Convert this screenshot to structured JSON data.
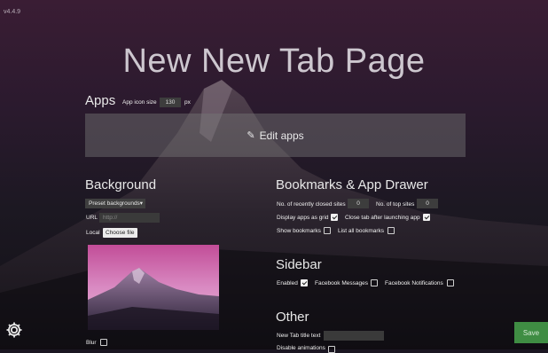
{
  "version": "v4.4.9",
  "page_title": "New New Tab Page",
  "apps": {
    "heading": "Apps",
    "icon_size_label": "App icon size",
    "icon_size_value": "130",
    "icon_size_unit": "px",
    "edit_label": "Edit apps"
  },
  "background": {
    "heading": "Background",
    "preset_label": "Preset backgrounds",
    "url_label": "URL",
    "url_placeholder": "http://",
    "local_label": "Local",
    "choose_file_label": "Choose file",
    "blur_label": "Blur"
  },
  "bookmarks": {
    "heading": "Bookmarks & App Drawer",
    "recently_closed_label": "No. of recently closed sites",
    "recently_closed_value": "0",
    "top_sites_label": "No. of top sites",
    "top_sites_value": "0",
    "display_grid_label": "Display apps as grid",
    "display_grid_checked": true,
    "close_tab_label": "Close tab after launching app",
    "close_tab_checked": true,
    "show_bookmarks_label": "Show bookmarks",
    "show_bookmarks_checked": false,
    "list_all_label": "List all bookmarks",
    "list_all_checked": false
  },
  "sidebar": {
    "heading": "Sidebar",
    "enabled_label": "Enabled",
    "enabled_checked": true,
    "fb_messages_label": "Facebook Messages",
    "fb_messages_checked": false,
    "fb_notifications_label": "Facebook Notifications",
    "fb_notifications_checked": false
  },
  "other": {
    "heading": "Other",
    "title_text_label": "New Tab title text",
    "title_text_value": "",
    "partial_label": "Disable animations"
  },
  "footer": {
    "save_label": "Save",
    "settings_icon": "gear-icon"
  },
  "colors": {
    "save_bg": "#3f8d43",
    "panel": "#787878"
  }
}
